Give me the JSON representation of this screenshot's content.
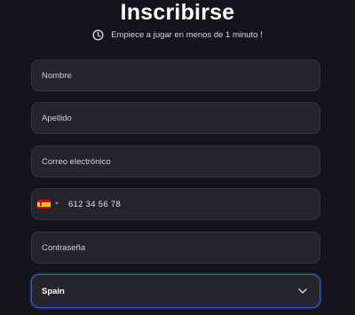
{
  "header": {
    "title": "Inscribirse",
    "subtitle": "Empiece a jugar en menos de 1 minuto !"
  },
  "form": {
    "first_name_placeholder": "Nombre",
    "last_name_placeholder": "Apellido",
    "email_placeholder": "Correo electrónico",
    "phone_country_icon": "spain-flag-icon",
    "phone_placeholder": "612 34 56 78",
    "password_placeholder": "Contraseña",
    "country_value": "Spain"
  },
  "colors": {
    "background": "#15141b",
    "field_bg": "#25242d",
    "focus_border": "#2f63c7"
  }
}
